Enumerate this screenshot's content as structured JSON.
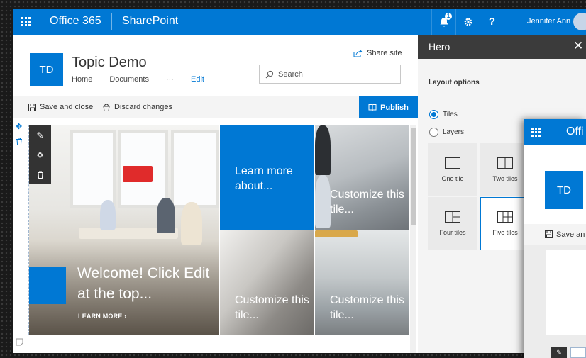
{
  "suitebar": {
    "app_name": "Office 365",
    "product_name": "SharePoint",
    "notification_count": "1",
    "help_label": "?",
    "user_name": "Jennifer Ann",
    "colors": {
      "brand": "#0078d4"
    }
  },
  "site": {
    "logo_initials": "TD",
    "title": "Topic Demo",
    "nav": [
      "Home",
      "Documents",
      "···",
      "Edit"
    ],
    "share_label": "Share site",
    "search_placeholder": "Search"
  },
  "command_bar": {
    "save_label": "Save and close",
    "discard_label": "Discard changes",
    "publish_label": "Publish"
  },
  "hero": {
    "main_tile": {
      "title": "Welcome! Click Edit at the top...",
      "link": "LEARN MORE"
    },
    "tiles": [
      {
        "title": "Learn more about..."
      },
      {
        "title": "Customize this tile..."
      },
      {
        "title": "Customize this tile..."
      },
      {
        "title": "Customize this tile..."
      }
    ]
  },
  "pane": {
    "title": "Hero",
    "close_glyph": "✕",
    "layout_label": "Layout options",
    "radios": [
      {
        "label": "Tiles",
        "checked": true
      },
      {
        "label": "Layers",
        "checked": false
      }
    ],
    "options": [
      {
        "label": "One tile",
        "selected": false
      },
      {
        "label": "Two tiles",
        "selected": false
      },
      {
        "label": "Four tiles",
        "selected": false
      },
      {
        "label": "Five tiles",
        "selected": true
      }
    ]
  },
  "second_window": {
    "app_name": "Offi",
    "logo_initials": "TD",
    "save_label": "Save an"
  }
}
